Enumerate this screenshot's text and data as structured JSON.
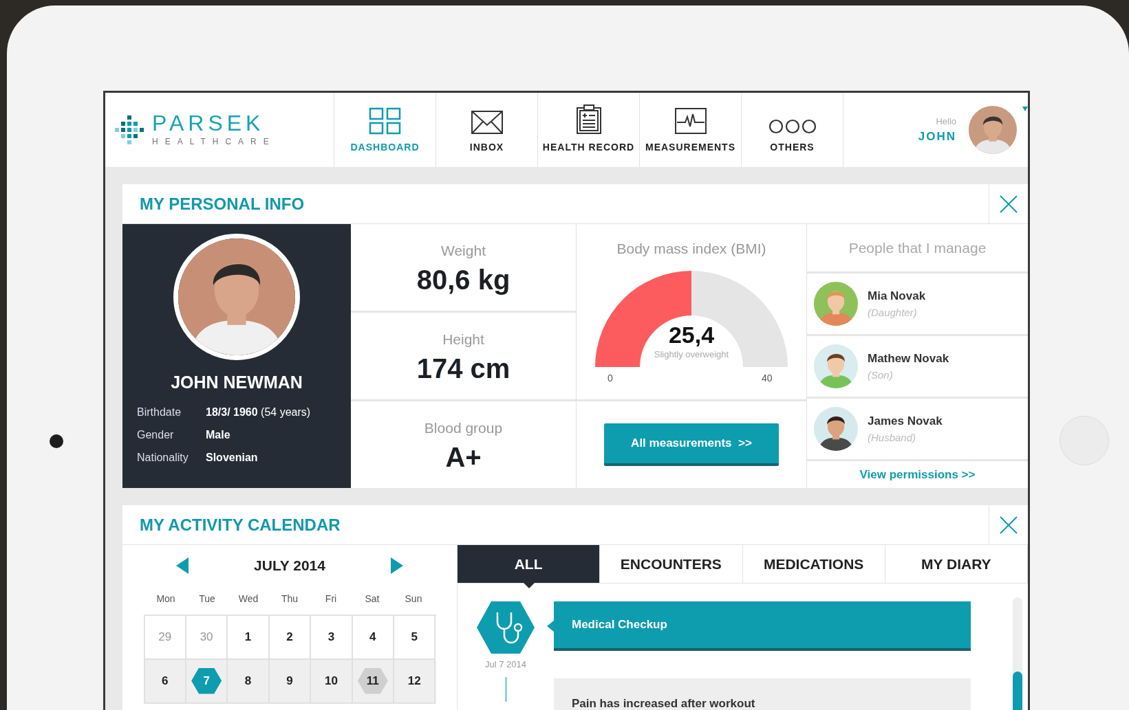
{
  "header": {
    "logo": {
      "name": "PARSEK",
      "tagline": "HEALTHCARE"
    },
    "nav": [
      {
        "label": "DASHBOARD",
        "kind": "grid",
        "selected": true
      },
      {
        "label": "INBOX",
        "kind": "envelope",
        "selected": false
      },
      {
        "label": "HEALTH RECORD",
        "kind": "clipboard",
        "selected": false
      },
      {
        "label": "MEASUREMENTS",
        "kind": "pulse",
        "selected": false
      },
      {
        "label": "OTHERS",
        "kind": "dots",
        "selected": false
      }
    ],
    "user": {
      "greeting": "Hello",
      "name": "JOHN"
    }
  },
  "personal_info": {
    "title": "MY PERSONAL INFO",
    "profile": {
      "name": "JOHN NEWMAN",
      "details": [
        {
          "label": "Birthdate",
          "value": "**18/3/ 1960** (54 years)"
        },
        {
          "label": "Gender",
          "value": "**Male**"
        },
        {
          "label": "Nationality",
          "value": "**Slovenian**"
        }
      ]
    },
    "stats": [
      {
        "label": "Weight",
        "value": "80,6 kg"
      },
      {
        "label": "Height",
        "value": "174 cm"
      },
      {
        "label": "Blood group",
        "value": "A+"
      }
    ],
    "bmi": {
      "title": "Body mass index (BMI)",
      "value": "25,4",
      "status": "Slightly overweight",
      "min": "0",
      "max": "40",
      "level": 0.5
    },
    "measurements_button": "All measurements  >>",
    "people": {
      "title": "People that I manage",
      "items": [
        {
          "name": "Mia Novak",
          "relation": "(Daughter)"
        },
        {
          "name": "Mathew Novak",
          "relation": "(Son)"
        },
        {
          "name": "James Novak",
          "relation": "(Husband)"
        }
      ],
      "link": "View permissions >>"
    }
  },
  "activity_calendar": {
    "title": "MY ACTIVITY CALENDAR",
    "calendar": {
      "month": "JULY 2014",
      "weekdays": [
        "Mon",
        "Tue",
        "Wed",
        "Thu",
        "Fri",
        "Sat",
        "Sun"
      ],
      "weeks": [
        {
          "current": false,
          "days": [
            {
              "label": "29",
              "kind": "outside"
            },
            {
              "label": "30",
              "kind": "outside"
            },
            {
              "label": "1",
              "kind": "normal"
            },
            {
              "label": "2",
              "kind": "normal"
            },
            {
              "label": "3",
              "kind": "normal"
            },
            {
              "label": "4",
              "kind": "normal"
            },
            {
              "label": "5",
              "kind": "normal"
            }
          ]
        },
        {
          "current": true,
          "days": [
            {
              "label": "6",
              "kind": "normal"
            },
            {
              "label": "7",
              "kind": "selected"
            },
            {
              "label": "8",
              "kind": "normal"
            },
            {
              "label": "9",
              "kind": "normal"
            },
            {
              "label": "10",
              "kind": "normal"
            },
            {
              "label": "11",
              "kind": "event"
            },
            {
              "label": "12",
              "kind": "normal"
            }
          ]
        }
      ]
    },
    "tabs": [
      {
        "label": "ALL",
        "selected": true
      },
      {
        "label": "ENCOUNTERS",
        "selected": false
      },
      {
        "label": "MEDICATIONS",
        "selected": false
      },
      {
        "label": "MY DIARY",
        "selected": false
      }
    ],
    "timeline": {
      "date": "Jul 7 2014",
      "entries": [
        {
          "kind": "encounter",
          "text": "Medical Checkup"
        },
        {
          "kind": "diary",
          "text": "Pain has increased after workout"
        }
      ]
    }
  }
}
